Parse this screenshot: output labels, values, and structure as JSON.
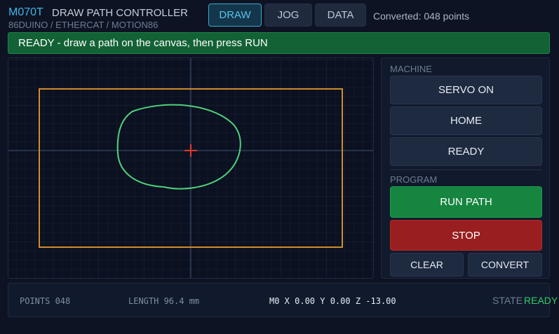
{
  "header": {
    "brand": "M070T",
    "title": "DRAW PATH CONTROLLER",
    "subtitle": "86DUINO / ETHERCAT / MOTION86",
    "tabs": [
      {
        "label": "DRAW",
        "active": true
      },
      {
        "label": "JOG",
        "active": false
      },
      {
        "label": "DATA",
        "active": false
      }
    ],
    "converted": "Converted: 048 points"
  },
  "status": {
    "message": "READY - draw a path on the canvas, then press RUN",
    "color": "#136236"
  },
  "canvas": {
    "boundary_color": "#d18b2a",
    "path_color": "#4fd17b",
    "origin_marker_color": "#e53935"
  },
  "sidebar": {
    "machine_label": "MACHINE",
    "machine_buttons": [
      "SERVO ON",
      "HOME",
      "READY"
    ],
    "program_label": "PROGRAM",
    "run_label": "RUN PATH",
    "stop_label": "STOP",
    "clear_label": "CLEAR",
    "convert_label": "CONVERT"
  },
  "footer": {
    "points": "POINTS 048",
    "length": "LENGTH 96.4 mm",
    "position": "M0 X 0.00 Y 0.00 Z -13.00",
    "state_label": "STATE",
    "state_value": "READY",
    "state_color": "#2ecc6a"
  }
}
